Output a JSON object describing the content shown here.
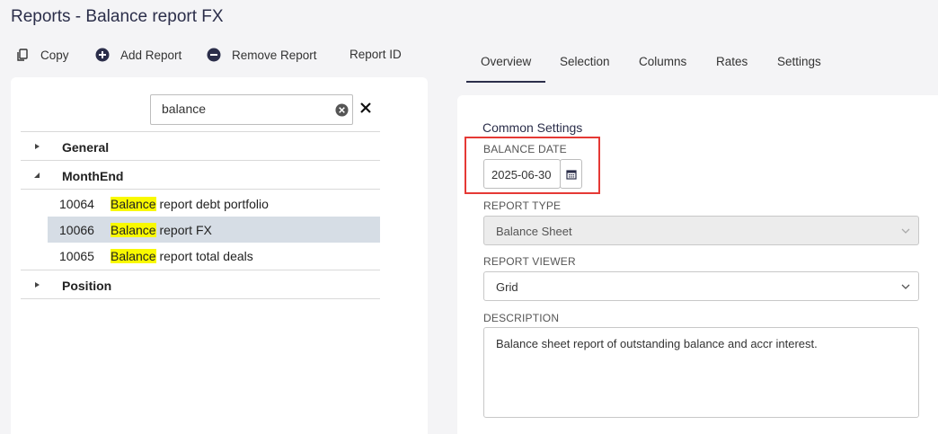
{
  "page": {
    "title": "Reports - Balance report FX"
  },
  "toolbar": {
    "copy_label": "Copy",
    "add_label": "Add Report",
    "remove_label": "Remove Report",
    "report_id_label": "Report ID"
  },
  "tabs": [
    {
      "label": "Overview",
      "active": true
    },
    {
      "label": "Selection"
    },
    {
      "label": "Columns"
    },
    {
      "label": "Rates"
    },
    {
      "label": "Settings"
    }
  ],
  "search": {
    "value": "balance"
  },
  "tree": {
    "groups": [
      {
        "label": "General",
        "expanded": false
      },
      {
        "label": "MonthEnd",
        "expanded": true,
        "items": [
          {
            "id": "10064",
            "highlight": "Balance",
            "rest": " report debt portfolio"
          },
          {
            "id": "10066",
            "highlight": "Balance",
            "rest": " report FX",
            "selected": true
          },
          {
            "id": "10065",
            "highlight": "Balance",
            "rest": " report total deals"
          }
        ]
      },
      {
        "label": "Position",
        "expanded": false
      }
    ]
  },
  "overview": {
    "section_title": "Common Settings",
    "balance_date_label": "BALANCE DATE",
    "balance_date_value": "2025-06-30",
    "report_type_label": "REPORT TYPE",
    "report_type_value": "Balance Sheet",
    "report_viewer_label": "REPORT VIEWER",
    "report_viewer_value": "Grid",
    "description_label": "DESCRIPTION",
    "description_value": "Balance sheet report of outstanding balance and accr interest."
  },
  "colors": {
    "accent": "#2b2e4a",
    "highlight": "#f9f900",
    "selected_row": "#d6dde5",
    "annotation": "#e53935"
  },
  "icons": [
    "copy-icon",
    "plus-circle-icon",
    "minus-circle-icon",
    "clear-search-icon",
    "close-icon",
    "calendar-icon",
    "chevron-down-icon",
    "tree-arrow-icon"
  ]
}
